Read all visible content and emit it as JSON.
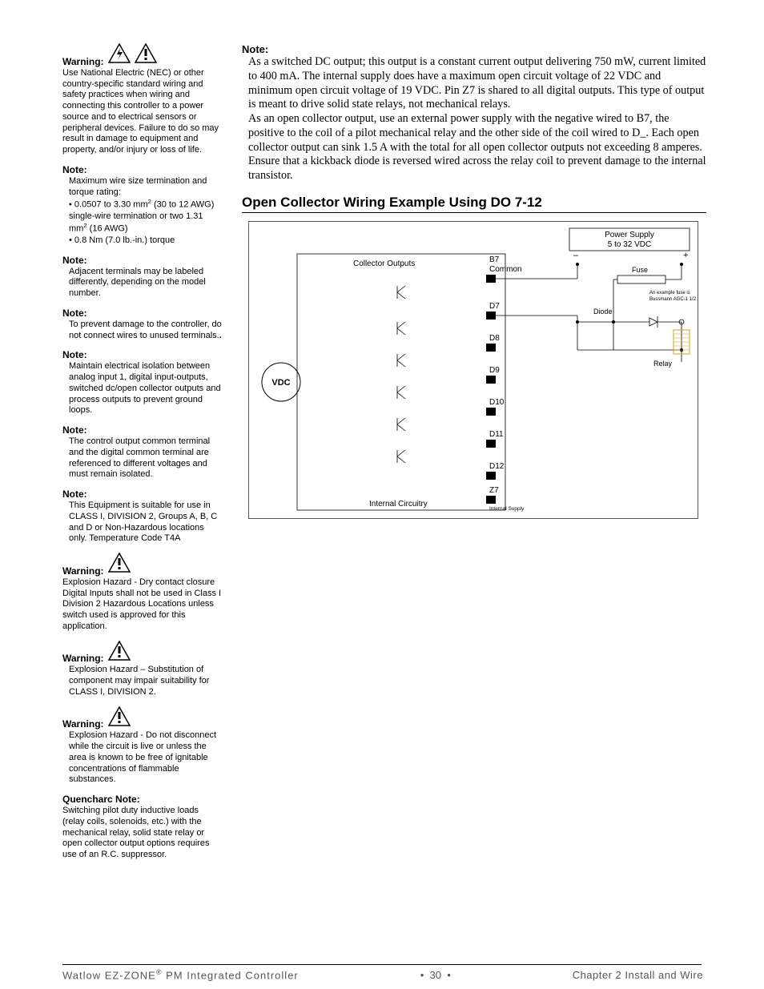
{
  "sidebar": {
    "warning1": {
      "label": "Warning:",
      "text": "Use National Electric (NEC) or other country-specific standard wiring and safety practices when wiring and connecting this controller to a power source and to electrical sensors or peripheral devices. Failure to do so may result in damage to equipment and property, and/or injury or loss of life."
    },
    "note1": {
      "label": "Note:",
      "line1": "Maximum wire size termination and torque rating:",
      "bullet1a": "• 0.0507 to 3.30 mm",
      "bullet1b": " (30 to 12 AWG) single-wire termination or two 1.31 mm",
      "bullet1c": " (16 AWG)",
      "bullet2": "• 0.8 Nm (7.0 lb.-in.) torque"
    },
    "note2": {
      "label": "Note:",
      "text": "Adjacent terminals may be labeled differently, depending on the model number."
    },
    "note3": {
      "label": "Note:",
      "text": "To prevent damage to the controller, do not connect wires to unused terminals."
    },
    "note4": {
      "label": "Note:",
      "text": "Maintain electrical isolation between analog input 1, digital input-outputs, switched dc/open collector outputs and process outputs to prevent ground loops."
    },
    "note5": {
      "label": "Note:",
      "text": "The control output common terminal and the digital common terminal are referenced to different voltages and must remain isolated."
    },
    "note6": {
      "label": "Note:",
      "text": "This Equipment is suitable for use in CLASS I, DIVISION 2, Groups A, B, C and D or Non-Hazardous locations only.  Temperature Code T4A"
    },
    "warning2": {
      "label": "Warning:",
      "text": "Explosion Hazard - Dry contact closure Digital Inputs shall not be used in Class I Division 2 Hazardous Locations unless switch used is approved for this application."
    },
    "warning3": {
      "label": "Warning:",
      "text": "Explosion Hazard – Substitution of component may impair suitability for CLASS I, DIVISION 2."
    },
    "warning4": {
      "label": "Warning:",
      "text": "Explosion Hazard - Do not disconnect while the circuit is live or unless the area is known to be free of ignitable concentrations of flammable substances."
    },
    "quencharc": {
      "label": "Quencharc Note:",
      "text": "Switching pilot duty inductive loads (relay coils, solenoids, etc.) with the mechanical relay, solid state relay or open collector output options requires use of an R.C. suppressor."
    }
  },
  "main": {
    "note_label": "Note:",
    "para1": "As a switched DC output; this output is a constant current output delivering 750 mW, current limited to 400 mA. The internal supply does have a maximum open circuit voltage of 22 VDC and minimum open circuit voltage of 19 VDC. Pin Z7 is shared to all digital outputs. This type of output is meant to drive solid state relays, not mechanical relays.",
    "para2": "As an open collector output, use an external power supply with the negative wired to B7, the positive to the coil of a pilot mechanical relay and the other side of the coil wired to D_. Each open collector output can sink 1.5 A with the total for all open collector outputs not exceeding 8 amperes. Ensure that a kickback diode is reversed wired across the relay coil to prevent damage to the internal transistor.",
    "section_title": "Open Collector Wiring Example Using DO 7-12"
  },
  "diagram": {
    "power_supply_l1": "Power Supply",
    "power_supply_l2": "5 to 32 VDC",
    "collector_outputs": "Collector Outputs",
    "b7": "B7",
    "common": "Common",
    "fuse": "Fuse",
    "fuse_note_l1": "An example fuse is",
    "fuse_note_l2": "Bussmann AGC-1 1/2",
    "d7": "D7",
    "diode": "Diode",
    "d8": "D8",
    "relay": "Relay",
    "d9": "D9",
    "vdc": "VDC",
    "d10": "D10",
    "d11": "D11",
    "d12": "D12",
    "z7": "Z7",
    "internal_supply": "Internal Supply",
    "internal_circuitry": "Internal Circuitry",
    "minus": "–",
    "plus": "+"
  },
  "footer": {
    "left_a": "Watlow EZ-ZONE",
    "left_b": " PM Integrated Controller",
    "mid_a": "•",
    "mid_page": "30",
    "mid_b": "•",
    "right": "Chapter 2 Install and Wire"
  }
}
